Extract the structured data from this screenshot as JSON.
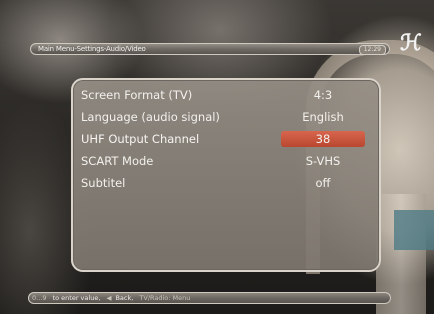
{
  "header": {
    "path": "Main Menu-Settings-Audio/Video",
    "clock": "12:29",
    "logo_glyph": "ℋ"
  },
  "menu": {
    "rows": [
      {
        "label": "Screen Format (TV)",
        "value": "4:3"
      },
      {
        "label": "Language (audio signal)",
        "value": "English"
      },
      {
        "label": "UHF Output Channel",
        "value": "38"
      },
      {
        "label": "SCART Mode",
        "value": "S-VHS"
      },
      {
        "label": "Subtitel",
        "value": "off"
      }
    ],
    "selected_index": 2,
    "selected_color": "#c8543c"
  },
  "footer": {
    "hint_keys": "0...9",
    "hint_enter": "to enter value,",
    "hint_back": "Back,",
    "hint_tvradio": "TV/Radio: Menu"
  }
}
